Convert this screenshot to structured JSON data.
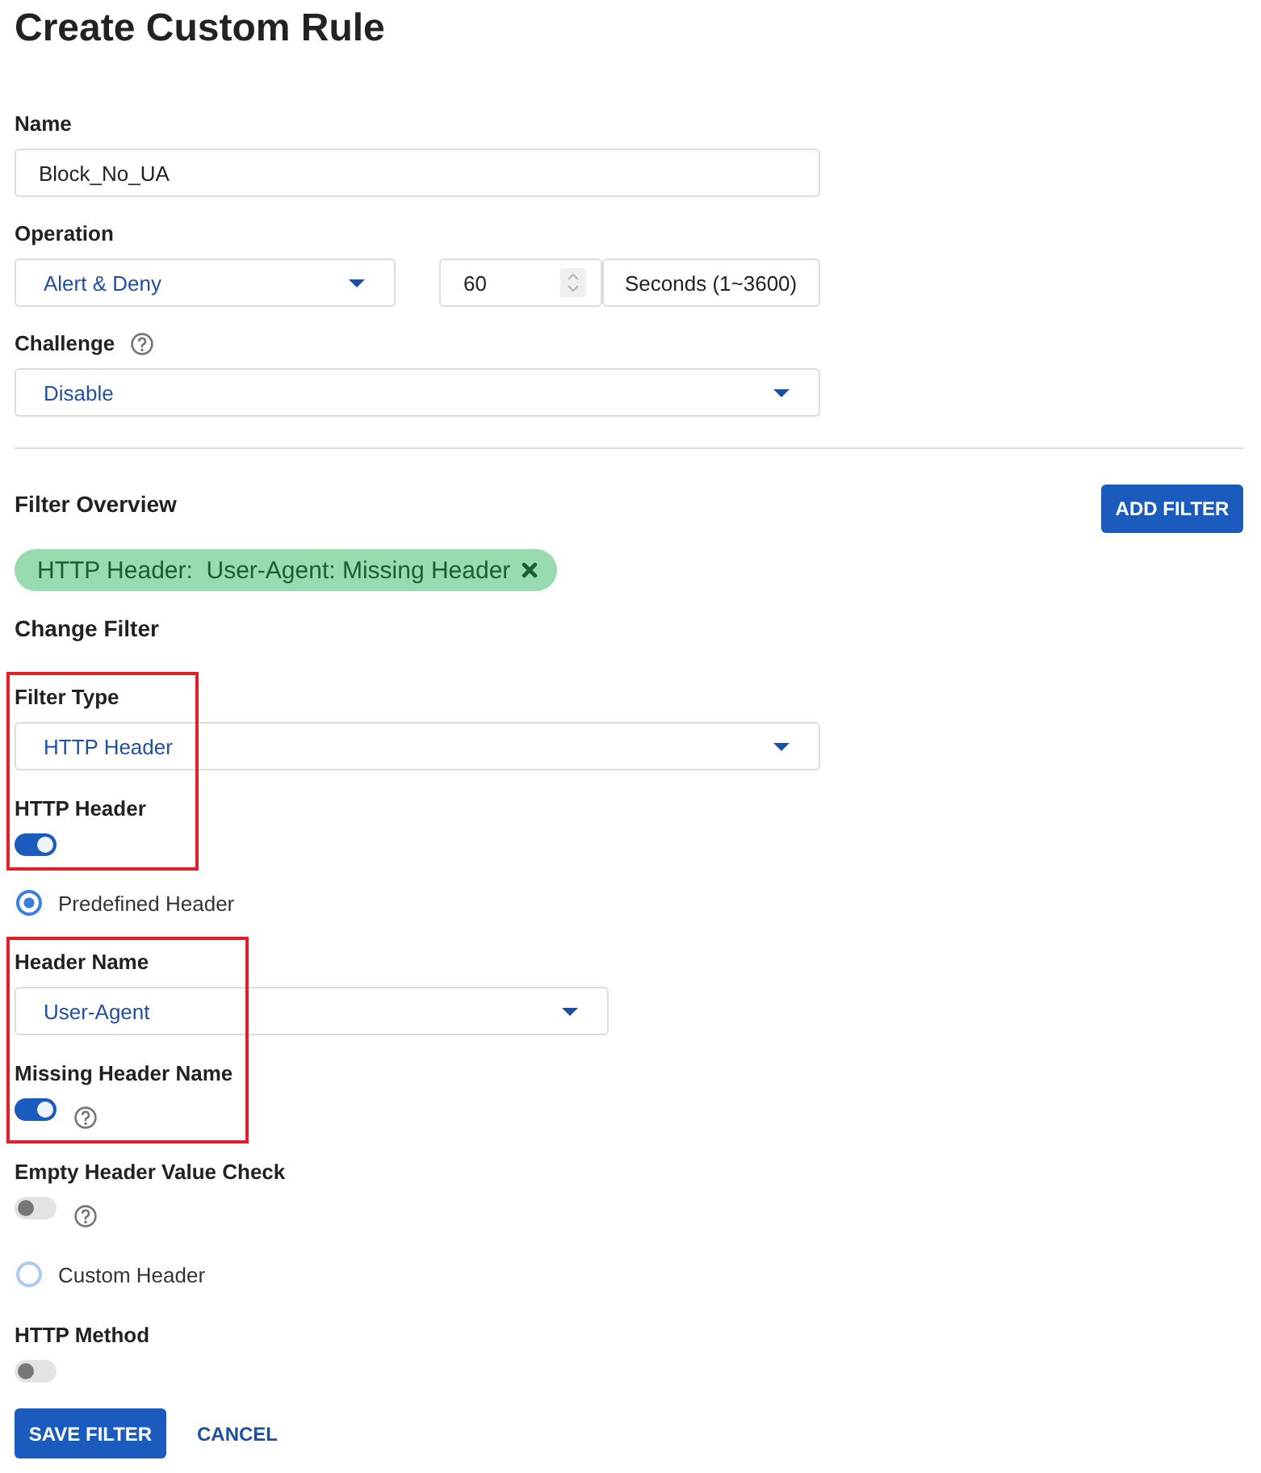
{
  "title": "Create Custom Rule",
  "name_field": {
    "label": "Name",
    "value": "Block_No_UA"
  },
  "operation": {
    "label": "Operation",
    "value": "Alert & Deny",
    "duration": "60",
    "unit": "Seconds (1~3600)"
  },
  "challenge": {
    "label": "Challenge",
    "value": "Disable"
  },
  "filter_overview": {
    "heading": "Filter Overview",
    "add_button": "ADD FILTER",
    "chips": [
      {
        "label": "HTTP Header:  User-Agent: Missing Header"
      }
    ]
  },
  "change_filter": {
    "heading": "Change Filter",
    "sections": [
      {
        "highlighted": true,
        "items": [
          {
            "kind": "select",
            "label": "Filter Type",
            "value": "HTTP Header"
          },
          {
            "kind": "toggle",
            "label": "HTTP Header",
            "on": true,
            "help": false
          }
        ]
      },
      {
        "highlighted": false,
        "items": [
          {
            "kind": "radio",
            "label": "Predefined Header",
            "selected": true,
            "children": [
              {
                "highlighted": true,
                "items": [
                  {
                    "kind": "select",
                    "label": "Header Name",
                    "value": "User-Agent"
                  },
                  {
                    "kind": "toggle",
                    "label": "Missing Header Name",
                    "on": true,
                    "help": true
                  }
                ]
              },
              {
                "highlighted": false,
                "items": [
                  {
                    "kind": "toggle",
                    "label": "Empty Header Value Check",
                    "on": false,
                    "help": true
                  }
                ]
              }
            ]
          },
          {
            "kind": "radio",
            "label": "Custom Header",
            "selected": false
          },
          {
            "kind": "toggle",
            "label": "HTTP Method",
            "on": false,
            "help": false
          }
        ]
      }
    ]
  },
  "buttons": {
    "save": "SAVE FILTER",
    "cancel": "CANCEL"
  }
}
